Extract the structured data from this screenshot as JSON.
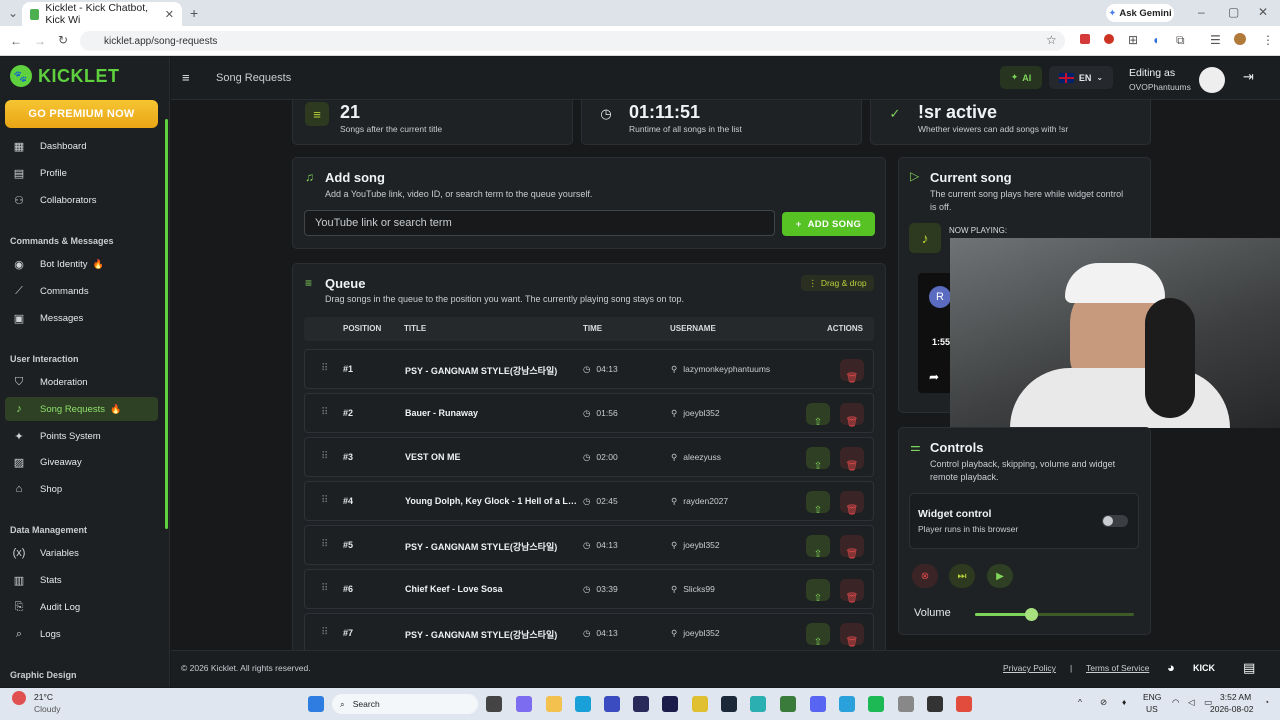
{
  "browser": {
    "tab_title": "Kicklet - Kick Chatbot, Kick Wi",
    "url": "kicklet.app/song-requests",
    "ask_gemini": "Ask Gemini"
  },
  "sidebar": {
    "logo": "KICKLET",
    "premium": "GO PREMIUM NOW",
    "items": [
      {
        "label": "Dashboard",
        "icon": "grid-icon"
      },
      {
        "label": "Profile",
        "icon": "profile-icon"
      },
      {
        "label": "Collaborators",
        "icon": "users-icon"
      }
    ],
    "section_commands": "Commands & Messages",
    "items2": [
      {
        "label": "Bot Identity",
        "icon": "bot-icon"
      },
      {
        "label": "Commands",
        "icon": "wand-icon"
      },
      {
        "label": "Messages",
        "icon": "message-icon"
      }
    ],
    "section_user": "User Interaction",
    "items3": [
      {
        "label": "Moderation",
        "icon": "shield-icon"
      },
      {
        "label": "Song Requests",
        "icon": "music-icon"
      },
      {
        "label": "Points System",
        "icon": "sparkle-icon"
      },
      {
        "label": "Giveaway",
        "icon": "gift-icon"
      },
      {
        "label": "Shop",
        "icon": "shop-icon"
      }
    ],
    "section_data": "Data Management",
    "items4": [
      {
        "label": "Variables",
        "icon": "variable-icon"
      },
      {
        "label": "Stats",
        "icon": "stats-icon"
      },
      {
        "label": "Audit Log",
        "icon": "audit-icon"
      },
      {
        "label": "Logs",
        "icon": "logs-icon"
      }
    ],
    "section_graphic": "Graphic Design"
  },
  "topbar": {
    "title": "Song Requests",
    "ai": "AI",
    "lang": "EN",
    "editing_as": "Editing as",
    "user": "OVOPhantuums"
  },
  "stats": [
    {
      "value": "21",
      "label": "Songs after the current title"
    },
    {
      "value": "01:11:51",
      "label": "Runtime of all songs in the list"
    },
    {
      "value": "!sr active",
      "label": "Whether viewers can add songs with !sr"
    }
  ],
  "add_song": {
    "title": "Add song",
    "subtitle": "Add a YouTube link, video ID, or search term to the queue yourself.",
    "placeholder": "YouTube link or search term",
    "button": "ADD SONG"
  },
  "queue": {
    "title": "Queue",
    "subtitle": "Drag songs in the queue to the position you want. The currently playing song stays on top.",
    "drag": "Drag & drop",
    "headers": {
      "position": "POSITION",
      "title": "TITLE",
      "time": "TIME",
      "username": "USERNAME",
      "actions": "ACTIONS"
    },
    "rows": [
      {
        "pos": "#1",
        "title": "PSY - GANGNAM STYLE(강남스타일)",
        "time": "04:13",
        "user": "lazymonkeyphantuums"
      },
      {
        "pos": "#2",
        "title": "Bauer - Runaway",
        "time": "01:56",
        "user": "joeybl352"
      },
      {
        "pos": "#3",
        "title": "VEST ON ME",
        "time": "02:00",
        "user": "aleezyuss"
      },
      {
        "pos": "#4",
        "title": "Young Dolph, Key Glock - 1 Hell of a Life",
        "time": "02:45",
        "user": "rayden2027"
      },
      {
        "pos": "#5",
        "title": "PSY - GANGNAM STYLE(강남스타일)",
        "time": "04:13",
        "user": "joeybl352"
      },
      {
        "pos": "#6",
        "title": "Chief Keef - Love Sosa",
        "time": "03:39",
        "user": "Slicks99"
      },
      {
        "pos": "#7",
        "title": "PSY - GANGNAM STYLE(강남스타일)",
        "time": "04:13",
        "user": "joeybl352"
      }
    ]
  },
  "current_song": {
    "title": "Current song",
    "subtitle": "The current song plays here while widget control is off.",
    "now_playing": "NOW PLAYING:",
    "avatar": "R",
    "time": "1:55"
  },
  "controls": {
    "title": "Controls",
    "subtitle": "Control playback, skipping, volume and widget remote playback.",
    "widget_title": "Widget control",
    "widget_sub": "Player runs in this browser",
    "volume": "Volume",
    "volume_level": 0.35
  },
  "footer": {
    "copyright": "© 2026 Kicklet. All rights reserved.",
    "privacy": "Privacy Policy",
    "sep": "|",
    "terms": "Terms of Service",
    "kick": "KICK"
  },
  "taskbar": {
    "temp": "21°C",
    "weather": "Cloudy",
    "search": "Search",
    "lang1": "ENG",
    "lang2": "US",
    "time": "3:52 AM",
    "date": "2026-08-02"
  }
}
